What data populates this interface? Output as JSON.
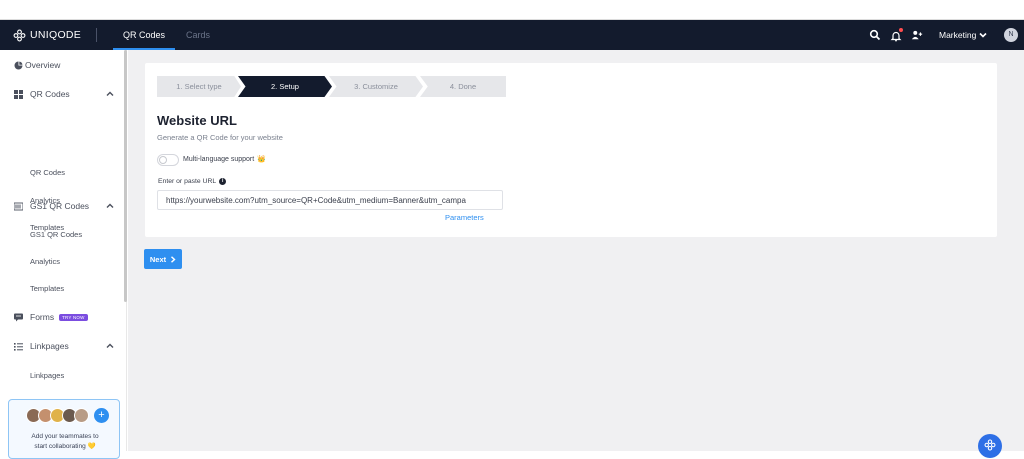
{
  "brand": {
    "name": "UNIQODE"
  },
  "topnav": {
    "tabs": [
      {
        "label": "QR Codes",
        "active": true
      },
      {
        "label": "Cards",
        "active": false
      }
    ],
    "workspace": "Marketing",
    "avatar_initial": "N"
  },
  "sidebar": {
    "overview": "Overview",
    "qr_codes": {
      "label": "QR Codes",
      "items": [
        "QR Codes",
        "Analytics",
        "Templates"
      ]
    },
    "gs1": {
      "label": "GS1 QR Codes",
      "items": [
        "GS1 QR Codes",
        "Analytics",
        "Templates"
      ]
    },
    "forms": {
      "label": "Forms",
      "badge": "TRY NOW"
    },
    "linkpages": {
      "label": "Linkpages",
      "items": [
        "Linkpages"
      ]
    },
    "team": {
      "line1": "Add your teammates to",
      "line2": "start collaborating 💛"
    }
  },
  "stepper": {
    "steps": [
      "1. Select type",
      "2. Setup",
      "3. Customize",
      "4. Done"
    ],
    "active_index": 1
  },
  "form": {
    "title": "Website URL",
    "subtitle": "Generate a QR Code for your website",
    "toggle_label": "Multi-language support",
    "crown": "👑",
    "url_label": "Enter or paste URL",
    "url_value": "https://yourwebsite.com?utm_source=QR+Code&utm_medium=Banner&utm_campa",
    "parameters_link": "Parameters"
  },
  "next_button": {
    "label": "Next"
  },
  "colors": {
    "nav_bg": "#131b2d",
    "accent": "#2e8ff0",
    "badge": "#7b4de0",
    "main_bg": "#f0f0f2"
  }
}
